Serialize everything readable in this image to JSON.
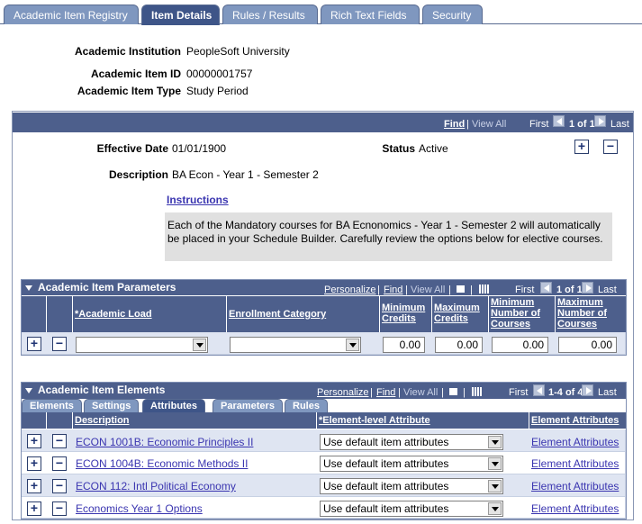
{
  "tabs": [
    {
      "label": "Academic Item Registry",
      "active": false
    },
    {
      "label": "Item Details",
      "active": true
    },
    {
      "label": "Rules / Results",
      "active": false
    },
    {
      "label": "Rich Text Fields",
      "active": false
    },
    {
      "label": "Security",
      "active": false
    }
  ],
  "header": {
    "institution_label": "Academic Institution",
    "institution_value": "PeopleSoft University",
    "item_id_label": "Academic Item ID",
    "item_id_value": "00000001757",
    "item_type_label": "Academic Item Type",
    "item_type_value": "Study Period"
  },
  "nav": {
    "find": "Find",
    "sep": "|",
    "view_all": "View All",
    "first": "First",
    "count": "1 of 1",
    "last": "Last"
  },
  "detail": {
    "effdate_label": "Effective Date",
    "effdate_value": "01/01/1900",
    "status_label": "Status",
    "status_value": "Active",
    "description_label": "Description",
    "description_value": "BA Econ - Year 1 - Semester 2",
    "instructions_link": "Instructions",
    "instructions_text": "Each of the Mandatory courses for BA Ecnonomics - Year 1 - Semester 2 will automatically be placed in your Schedule Builder. Carefully review the options below for elective courses."
  },
  "params": {
    "title": "Academic Item Parameters",
    "personalize": "Personalize",
    "find": "Find",
    "view_all": "View All",
    "first": "First",
    "count": "1 of 1",
    "last": "Last",
    "col_load": "*Academic Load",
    "col_enroll": "Enrollment Category",
    "col_min_credits": "Minimum Credits",
    "col_max_credits": "Maximum Credits",
    "col_min_courses": "Minimum Number of Courses",
    "col_max_courses": "Maximum Number of Courses",
    "row": {
      "load": "",
      "enroll": "",
      "min_credits": "0.00",
      "max_credits": "0.00",
      "min_courses": "0.00",
      "max_courses": "0.00"
    }
  },
  "elements": {
    "title": "Academic Item Elements",
    "personalize": "Personalize",
    "find": "Find",
    "view_all": "View All",
    "first": "First",
    "count": "1-4 of 4",
    "last": "Last",
    "subtabs": [
      "Elements",
      "Settings",
      "Attributes",
      "Parameters",
      "Rules"
    ],
    "active_subtab": "Attributes",
    "col_desc": "Description",
    "col_attr": "*Element-level Attribute",
    "col_elem_attr": "Element Attributes",
    "rows": [
      {
        "desc": "ECON 1001B: Economic Principles II",
        "attr": "Use default item attributes",
        "link": "Element Attributes"
      },
      {
        "desc": "ECON 1004B: Economic Methods II",
        "attr": "Use default item attributes",
        "link": "Element Attributes"
      },
      {
        "desc": "ECON 112: Intl Political Economy",
        "attr": "Use default item attributes",
        "link": "Element Attributes"
      },
      {
        "desc": "Economics Year 1 Options",
        "attr": "Use default item attributes",
        "link": "Element Attributes"
      }
    ]
  },
  "icons": {
    "add": "+",
    "remove": "−"
  },
  "colors": {
    "header_blue": "#4d5f8c",
    "tab_blue": "#7f97bf",
    "active_tab": "#3e5588",
    "link": "#3a35b0",
    "row_bg": "#dfe5f2"
  }
}
